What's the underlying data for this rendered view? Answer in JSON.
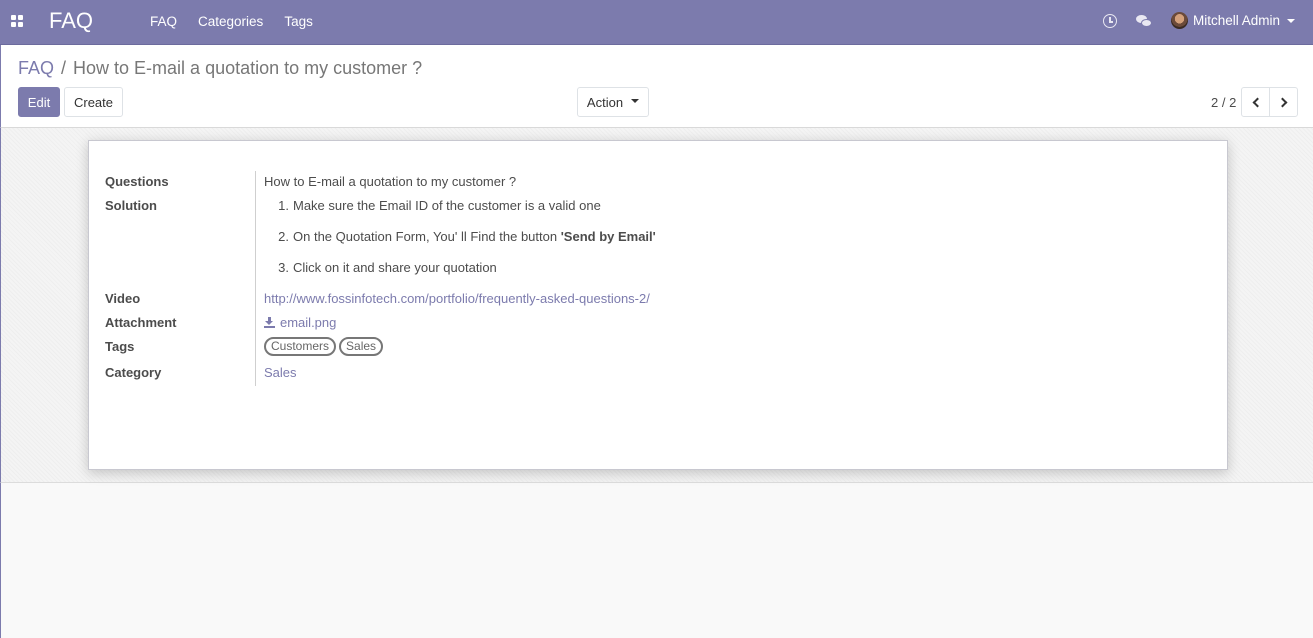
{
  "navbar": {
    "brand": "FAQ",
    "menu": [
      "FAQ",
      "Categories",
      "Tags"
    ],
    "user_name": "Mitchell Admin"
  },
  "breadcrumb": {
    "parent": "FAQ",
    "separator": "/",
    "current": "How to E-mail a quotation to my customer ?"
  },
  "buttons": {
    "edit": "Edit",
    "create": "Create",
    "action": "Action"
  },
  "pager": {
    "value": "2 / 2"
  },
  "form": {
    "labels": {
      "questions": "Questions",
      "solution": "Solution",
      "video": "Video",
      "attachment": "Attachment",
      "tags": "Tags",
      "category": "Category"
    },
    "question": "How to E-mail a quotation to my customer ?",
    "solution_items": [
      {
        "n": "1.",
        "text": "Make sure the Email ID of the customer is a valid one",
        "bold": ""
      },
      {
        "n": "2.",
        "text": "On the Quotation Form, You' ll Find the button ",
        "bold": "'Send by Email'"
      },
      {
        "n": "3.",
        "text": "Click on it and share your quotation",
        "bold": ""
      }
    ],
    "video": "http://www.fossinfotech.com/portfolio/frequently-asked-questions-2/",
    "attachment": "email.png",
    "tags": [
      "Customers",
      "Sales"
    ],
    "category": "Sales"
  },
  "colors": {
    "brand": "#7c7bad",
    "text": "#4c4c4c"
  }
}
